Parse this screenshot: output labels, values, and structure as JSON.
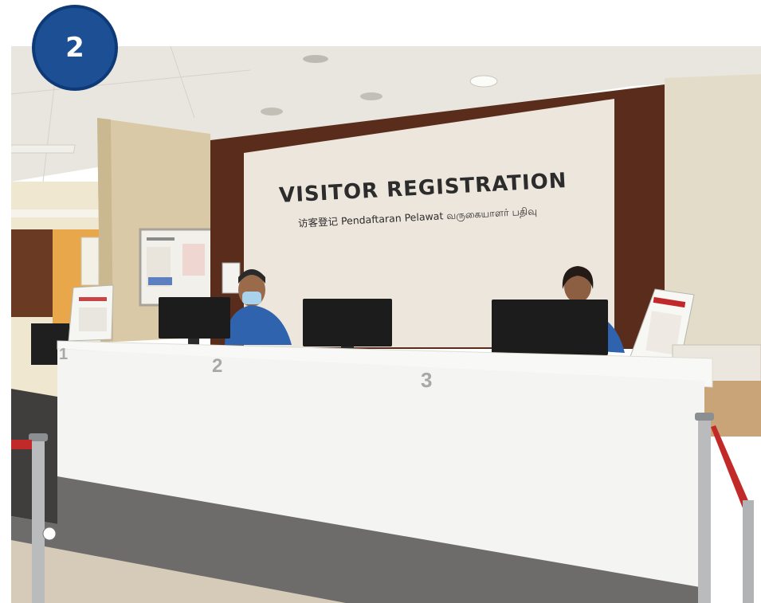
{
  "badge": {
    "number": "2"
  },
  "sign": {
    "title": "VISITOR  REGISTRATION",
    "subtitle": "访客登记  Pendaftaran Pelawat  வருகையாளர் பதிவு"
  },
  "counters": [
    "1",
    "2",
    "3"
  ],
  "colors": {
    "badge": "#1c4f93",
    "wall_panel": "#ede6dc",
    "wood_frame": "#5a2c1c",
    "counter_front": "#f4f4f2",
    "staff_uniform": "#2f63ad"
  }
}
